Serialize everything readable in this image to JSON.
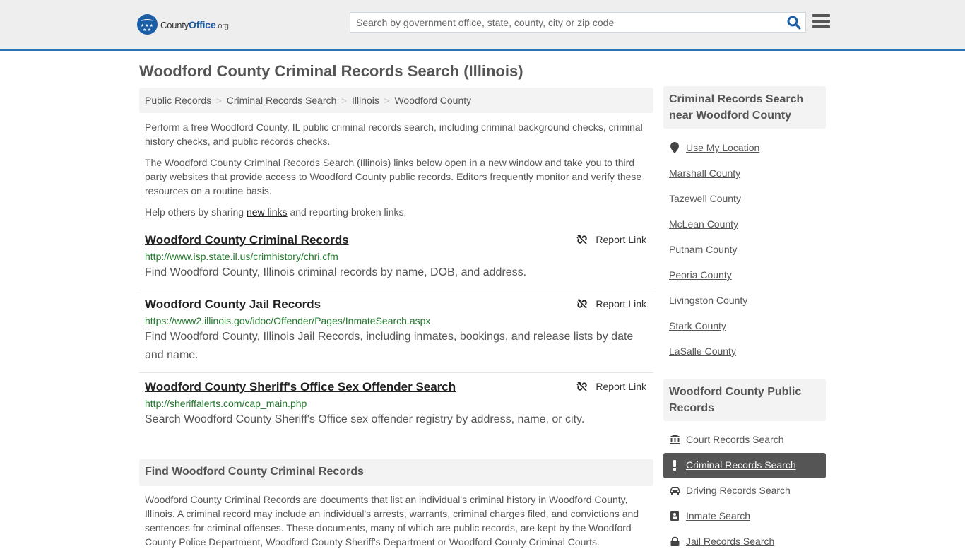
{
  "header": {
    "logo": {
      "name_part1": "County",
      "name_part2": "Office",
      "name_part3": ".org"
    },
    "search": {
      "placeholder": "Search by government office, state, county, city or zip code",
      "value": ""
    },
    "icons": {
      "search": "search-icon",
      "menu": "hamburger-menu-icon"
    }
  },
  "page": {
    "title": "Woodford County Criminal Records Search (Illinois)"
  },
  "breadcrumb": [
    {
      "label": "Public Records"
    },
    {
      "label": "Criminal Records Search"
    },
    {
      "label": "Illinois"
    },
    {
      "label": "Woodford County"
    }
  ],
  "intro": {
    "p1": "Perform a free Woodford County, IL public criminal records search, including criminal background checks, criminal history checks, and public records checks.",
    "p2": "The Woodford County Criminal Records Search (Illinois) links below open in a new window and take you to third party websites that provide access to Woodford County public records. Editors frequently monitor and verify these resources on a routine basis.",
    "p3_before": "Help others by sharing ",
    "p3_link": "new links",
    "p3_after": " and reporting broken links."
  },
  "listings": [
    {
      "title": "Woodford County Criminal Records",
      "url": "http://www.isp.state.il.us/crimhistory/chri.cfm",
      "description": "Find Woodford County, Illinois criminal records by name, DOB, and address.",
      "report_label": "Report Link"
    },
    {
      "title": "Woodford County Jail Records",
      "url": "https://www2.illinois.gov/idoc/Offender/Pages/InmateSearch.aspx",
      "description": "Find Woodford County, Illinois Jail Records, including inmates, bookings, and release lists by date and name.",
      "report_label": "Report Link"
    },
    {
      "title": "Woodford County Sheriff's Office Sex Offender Search",
      "url": "http://sheriffalerts.com/cap_main.php",
      "description": "Search Woodford County Sheriff's Office sex offender registry by address, name, or city.",
      "report_label": "Report Link"
    }
  ],
  "find_section": {
    "title": "Find Woodford County Criminal Records",
    "body": "Woodford County Criminal Records are documents that list an individual's criminal history in Woodford County, Illinois. A criminal record may include an individual's arrests, warrants, criminal charges filed, and convictions and sentences for criminal offenses. These documents, many of which are public records, are kept by the Woodford County Police Department, Woodford County Sheriff's Department or Woodford County Criminal Courts."
  },
  "sidebar": {
    "nearby": {
      "title": "Criminal Records Search near Woodford County",
      "use_location": "Use My Location",
      "counties": [
        "Marshall County",
        "Tazewell County",
        "McLean County",
        "Putnam County",
        "Peoria County",
        "Livingston County",
        "Stark County",
        "LaSalle County"
      ]
    },
    "public_records": {
      "title": "Woodford County Public Records",
      "items": [
        {
          "label": "Court Records Search",
          "icon": "courthouse-icon",
          "active": false
        },
        {
          "label": "Criminal Records Search",
          "icon": "exclamation-icon",
          "active": true
        },
        {
          "label": "Driving Records Search",
          "icon": "car-icon",
          "active": false
        },
        {
          "label": "Inmate Search",
          "icon": "id-badge-icon",
          "active": false
        },
        {
          "label": "Jail Records Search",
          "icon": "lock-icon",
          "active": false
        }
      ]
    }
  }
}
